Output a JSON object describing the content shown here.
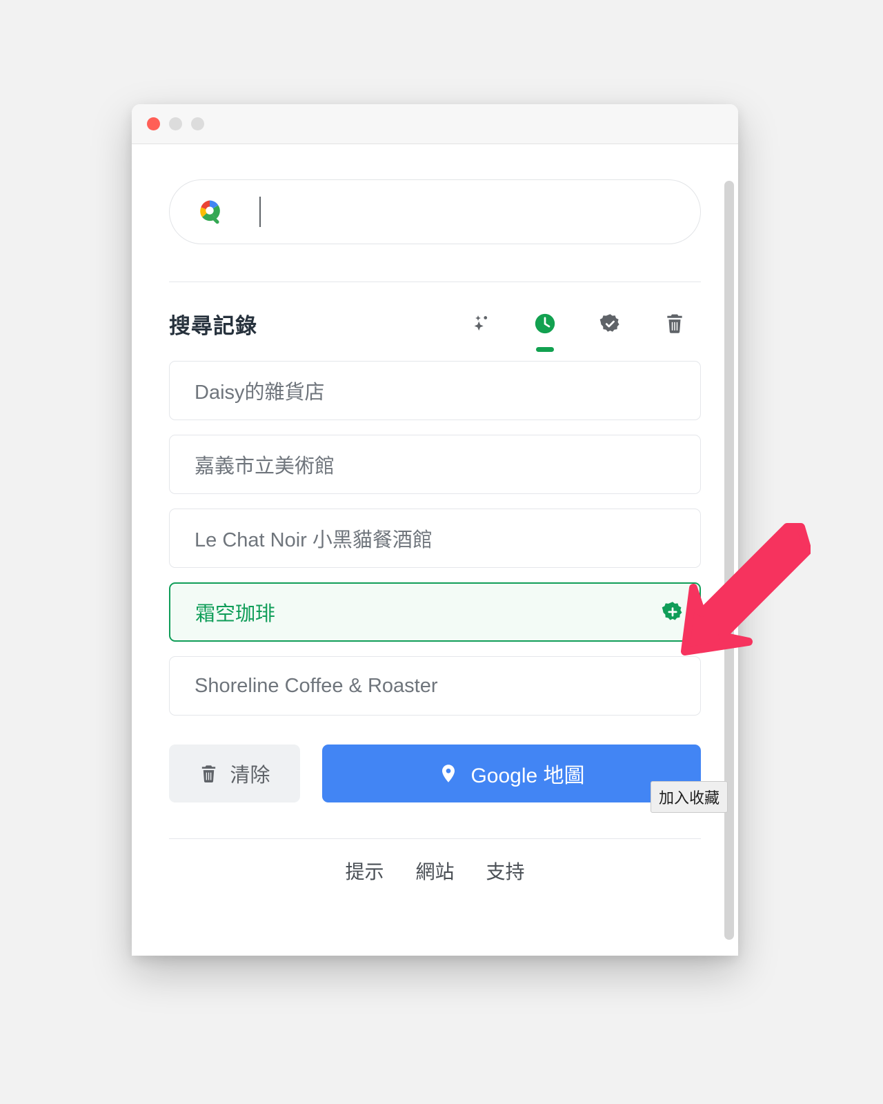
{
  "window": {
    "traffic_lights": [
      "close",
      "minimize",
      "maximize"
    ]
  },
  "search": {
    "value": "",
    "placeholder": "",
    "icon": "google-search-icon"
  },
  "history_section": {
    "title": "搜尋記錄",
    "tools": [
      {
        "name": "sparkle-icon",
        "label": "AI 建議",
        "active": false
      },
      {
        "name": "clock-icon",
        "label": "搜尋記錄",
        "active": true
      },
      {
        "name": "badge-check-icon",
        "label": "收藏",
        "active": false
      },
      {
        "name": "trash-icon",
        "label": "刪除",
        "active": false
      }
    ],
    "items": [
      {
        "label": "Daisy的雜貨店",
        "selected": false
      },
      {
        "label": "嘉義市立美術館",
        "selected": false
      },
      {
        "label": "Le Chat Noir 小黑貓餐酒館",
        "selected": false
      },
      {
        "label": "霜空珈琲",
        "selected": true,
        "badge": "add-favorite-badge"
      },
      {
        "label": "Shoreline Coffee & Roaster",
        "selected": false
      }
    ]
  },
  "tooltip": {
    "text": "加入收藏"
  },
  "actions": {
    "clear_label": "清除",
    "clear_icon": "trash-icon",
    "maps_label": "Google 地圖",
    "maps_icon": "map-pin-icon"
  },
  "footer": {
    "links": [
      "提示",
      "網站",
      "支持"
    ]
  },
  "colors": {
    "accent_green": "#0f9d58",
    "tool_green": "#12a150",
    "maps_blue": "#4285f4",
    "arrow_pink": "#f6335e",
    "muted_text": "#6f757c"
  }
}
